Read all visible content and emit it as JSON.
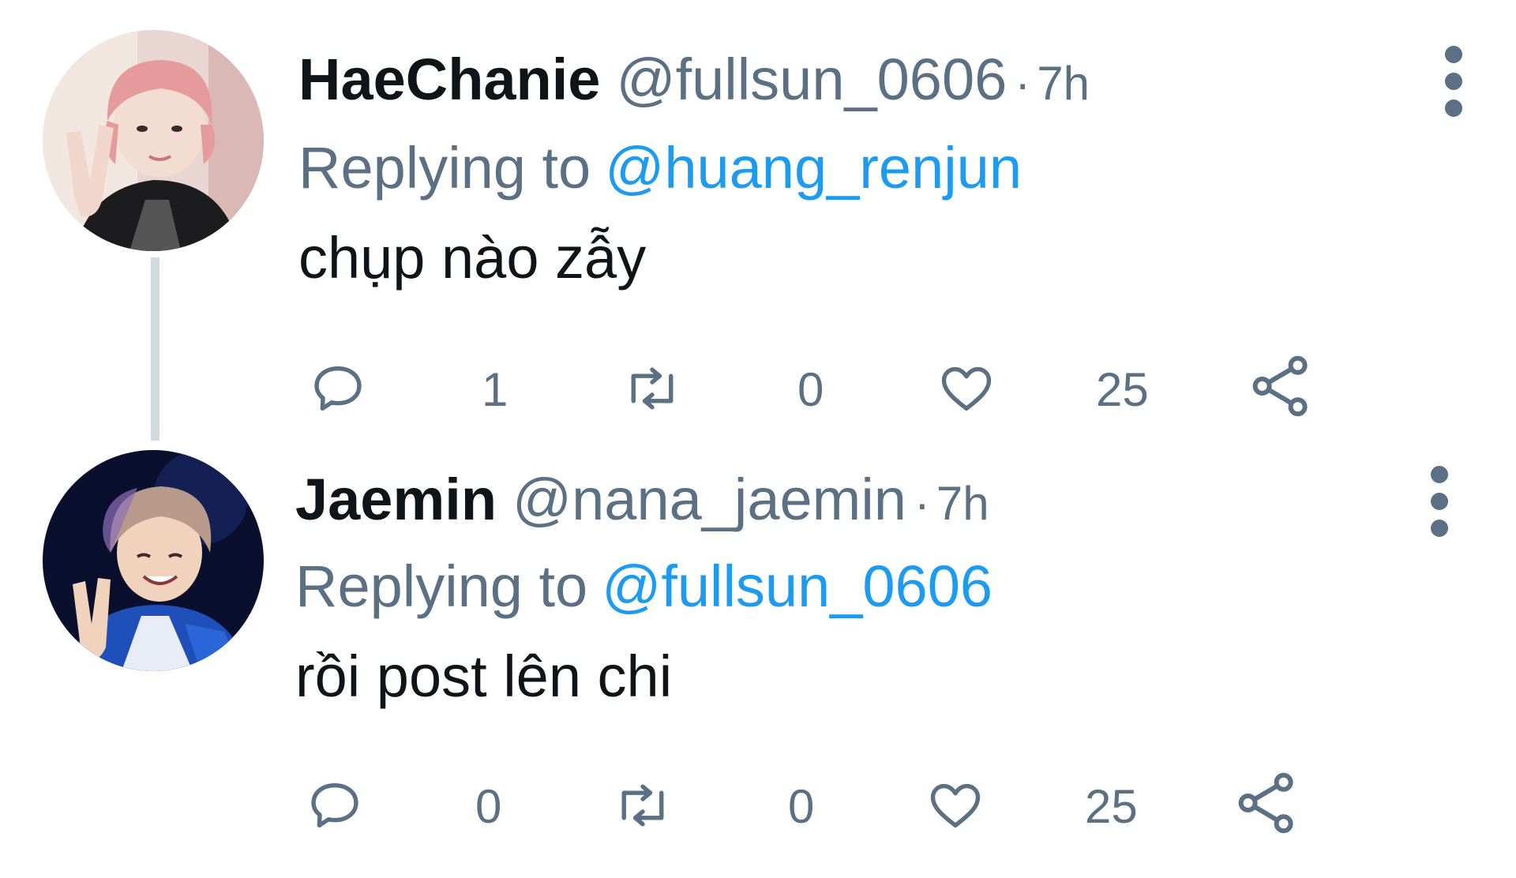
{
  "tweets": [
    {
      "name": "HaeChanie",
      "handle": "@fullsun_0606",
      "separator": "·",
      "time": "7h",
      "replying_prefix": "Replying to",
      "replying_to": "@huang_renjun",
      "text": "chụp nào zẫy",
      "replies": "1",
      "retweets": "0",
      "likes": "25"
    },
    {
      "name": "Jaemin",
      "handle": "@nana_jaemin",
      "separator": "·",
      "time": "7h",
      "replying_prefix": "Replying to",
      "replying_to": "@fullsun_0606",
      "text": "rồi post lên chi",
      "replies": "0",
      "retweets": "0",
      "likes": "25"
    }
  ],
  "icons": {
    "reply": "reply-icon",
    "retweet": "retweet-icon",
    "like": "heart-icon",
    "share": "share-icon",
    "more": "more-vertical-icon"
  },
  "colors": {
    "text": "#0f1419",
    "secondary": "#5b7083",
    "mention": "#1d9bf0",
    "thread_line": "#cfd9de"
  }
}
